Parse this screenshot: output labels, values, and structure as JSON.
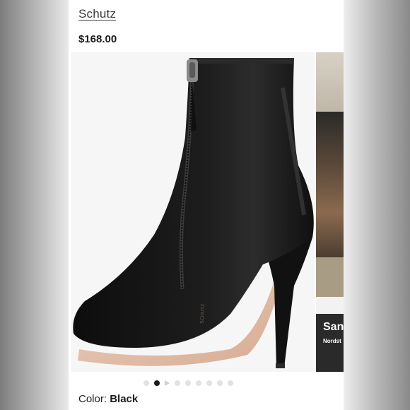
{
  "product": {
    "brand": "Schutz",
    "price": "$168.00",
    "color_label": "Color:",
    "color_value": "Black"
  },
  "carousel": {
    "total_slides": 9,
    "active_index": 1,
    "video_index": 2,
    "next_card": {
      "title": "San",
      "subtitle": "Nordst"
    }
  },
  "colors": {
    "boot": "#141414",
    "sole": "#e2bca6",
    "background": "#f6f6f6"
  }
}
